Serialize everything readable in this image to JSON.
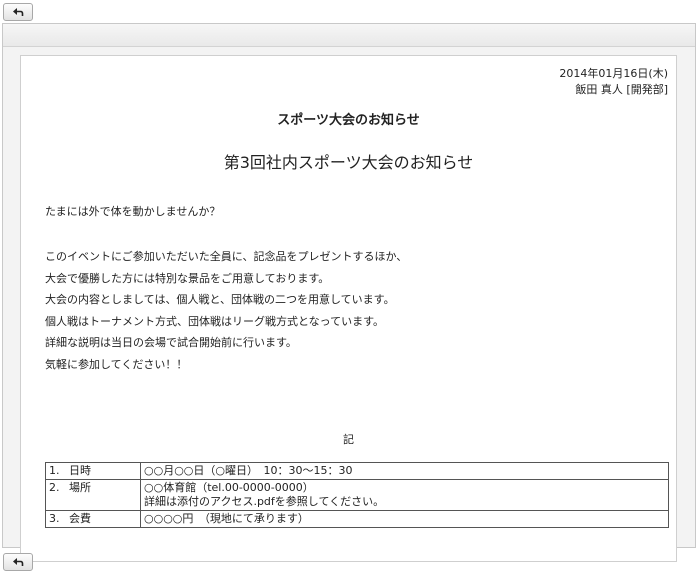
{
  "toolbar": {
    "back_icon": "back-arrow-icon"
  },
  "document": {
    "date": "2014年01月16日(木)",
    "author": "飯田 真人 [開発部]",
    "notice_title": "スポーツ大会のお知らせ",
    "event_title": "第3回社内スポーツ大会のお知らせ",
    "greeting": "たまには外で体を動かしませんか？",
    "body_lines": [
      "このイベントにご参加いただいた全員に、記念品をプレゼントするほか、",
      "大会で優勝した方には特別な景品をご用意しております。",
      "大会の内容としましては、個人戦と、団体戦の二つを用意しています。",
      "個人戦はトーナメント方式、団体戦はリーグ戦方式となっています。",
      "詳細な説明は当日の会場で試合開始前に行います。",
      "気軽に参加してください！！"
    ],
    "ki": "記",
    "details": [
      {
        "num": "1.",
        "label": "日時",
        "lines": [
          "○○月○○日（○曜日）　10：30〜15：30"
        ]
      },
      {
        "num": "2.",
        "label": "場所",
        "lines": [
          "○○体育館（tel.00-0000-0000）",
          "詳細は添付のアクセス.pdfを参照してください。"
        ]
      },
      {
        "num": "3.",
        "label": "会費",
        "lines": [
          "○○○○円　（現地にて承ります）"
        ]
      }
    ]
  }
}
